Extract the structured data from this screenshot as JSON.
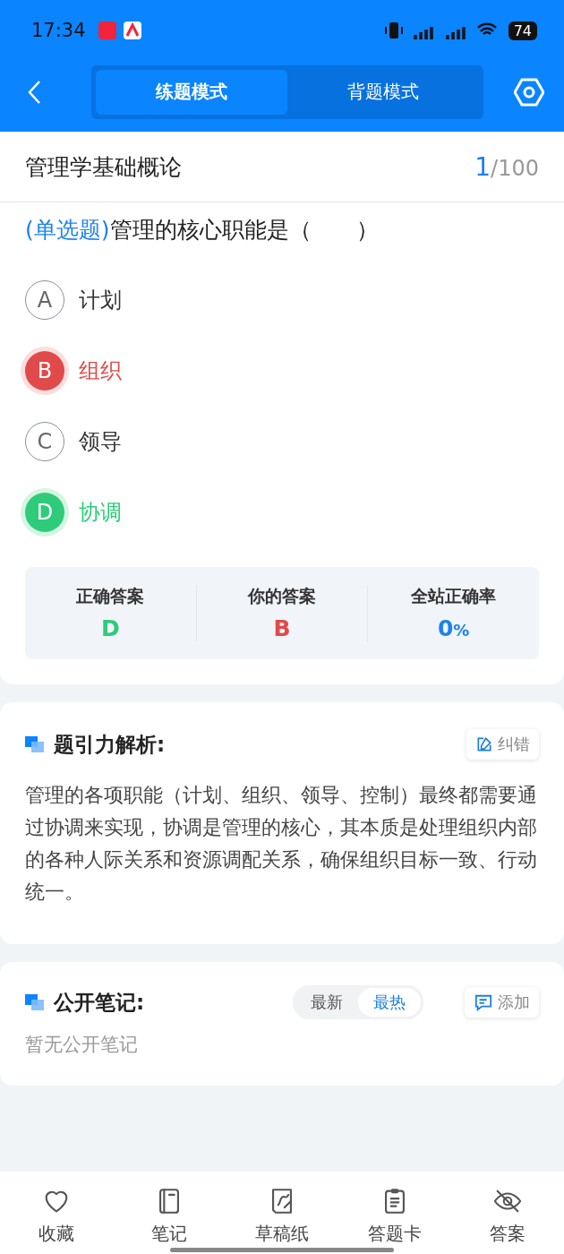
{
  "status_bar": {
    "time": "17:34",
    "battery": "74"
  },
  "mode_tabs": [
    {
      "label": "练题模式",
      "selected": true
    },
    {
      "label": "背题模式",
      "selected": false
    }
  ],
  "subject": {
    "title": "管理学基础概论",
    "current": "1",
    "total": "/100"
  },
  "question": {
    "type": "(单选题)",
    "text": "管理的核心职能是（　　）"
  },
  "options": [
    {
      "letter": "A",
      "text": "计划",
      "kind": "none"
    },
    {
      "letter": "B",
      "text": "组织",
      "kind": "wrong"
    },
    {
      "letter": "C",
      "text": "领导",
      "kind": "none"
    },
    {
      "letter": "D",
      "text": "协调",
      "kind": "correct"
    }
  ],
  "summary": [
    {
      "label": "正确答案",
      "value": "D",
      "kind": "correct"
    },
    {
      "label": "你的答案",
      "value": "B",
      "kind": "wrong"
    },
    {
      "label": "全站正确率",
      "value": "0",
      "unit": "%",
      "kind": "rate"
    }
  ],
  "analysis": {
    "title": "题引力解析:",
    "action": "纠错",
    "text": "管理的各项职能（计划、组织、领导、控制）最终都需要通过协调来实现，协调是管理的核心，其本质是处理组织内部的各种人际关系和资源调配关系，确保组织目标一致、行动统一。"
  },
  "notes": {
    "title": "公开笔记:",
    "sort_tabs": [
      {
        "label": "最新",
        "selected": false
      },
      {
        "label": "最热",
        "selected": true
      }
    ],
    "action": "添加",
    "empty": "暂无公开笔记"
  },
  "bottom_bar": [
    {
      "label": "收藏"
    },
    {
      "label": "笔记"
    },
    {
      "label": "草稿纸"
    },
    {
      "label": "答题卡"
    },
    {
      "label": "答案"
    }
  ]
}
